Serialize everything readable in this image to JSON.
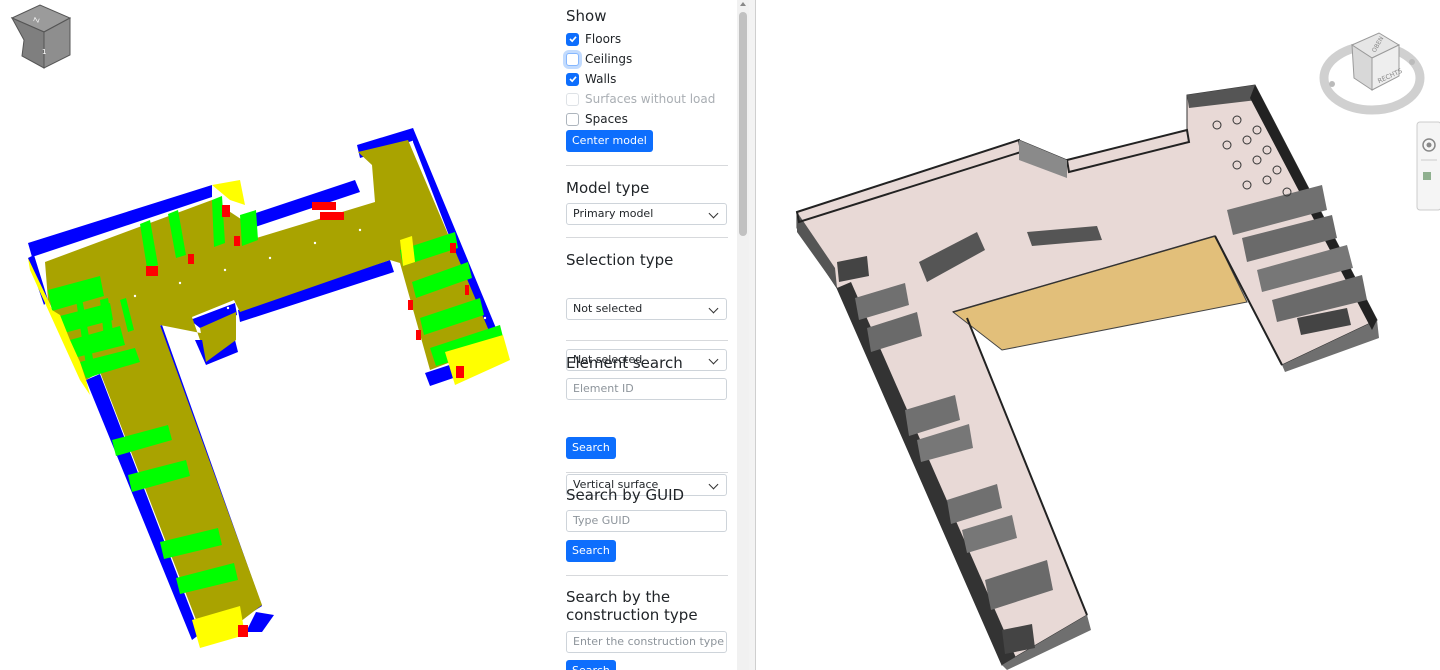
{
  "panel": {
    "show": {
      "heading": "Show",
      "floors": "Floors",
      "ceilings": "Ceilings",
      "walls": "Walls",
      "surfaces_without_load": "Surfaces without load",
      "spaces": "Spaces",
      "center_button": "Center model"
    },
    "model_type": {
      "heading": "Model type",
      "selected": "Primary model"
    },
    "selection_type": {
      "heading": "Selection type",
      "first": "Not selected",
      "second": "Not selected"
    },
    "element_search": {
      "heading": "Element search",
      "placeholder": "Element ID",
      "surface": "Vertical surface",
      "button": "Search"
    },
    "guid_search": {
      "heading": "Search by GUID",
      "placeholder": "Type GUID",
      "button": "Search"
    },
    "construction_search": {
      "heading": "Search by the construction type",
      "placeholder": "Enter the construction type",
      "button": "Search"
    }
  },
  "left_view": {
    "cube_top_label": "Z",
    "cube_front_label": "1"
  },
  "right_view": {
    "viewcube_top": "OBEN",
    "viewcube_side": "RECHTS"
  },
  "colors": {
    "accent": "#0d6efd",
    "floor": "#a9a300",
    "wall_green": "#00ff00",
    "wall_blue": "#0000ff",
    "wall_yellow": "#ffff00",
    "opening_red": "#ff0000",
    "revit_floor": "#e8d9d6",
    "revit_atrium": "#e2bf7a"
  }
}
